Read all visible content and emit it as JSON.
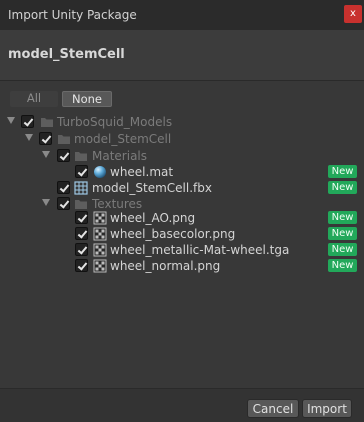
{
  "window": {
    "title": "Import Unity Package",
    "close_label": "x"
  },
  "header": {
    "package_name": "model_StemCell"
  },
  "selection": {
    "all_label": "All",
    "none_label": "None"
  },
  "tree": {
    "root": "TurboSquid_Models",
    "folder_model": "model_StemCell",
    "folder_materials": "Materials",
    "wheel_mat": "wheel.mat",
    "fbx": "model_StemCell.fbx",
    "folder_textures": "Textures",
    "tex_ao": "wheel_AO.png",
    "tex_basecolor": "wheel_basecolor.png",
    "tex_metallic": "wheel_metallic-Mat-wheel.tga",
    "tex_normal": "wheel_normal.png",
    "new_badge": "New"
  },
  "footer": {
    "cancel_label": "Cancel",
    "import_label": "Import"
  },
  "colors": {
    "accent_new": "#22a85a",
    "close": "#c8312e"
  }
}
